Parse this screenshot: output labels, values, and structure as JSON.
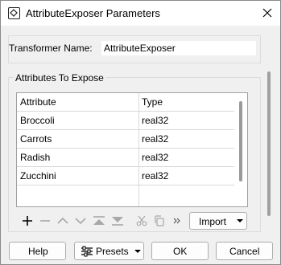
{
  "window": {
    "title": "AttributeExposer Parameters",
    "icons": {
      "app": "transformer-icon",
      "close": "close-icon"
    }
  },
  "transformer_name": {
    "label": "Transformer Name:",
    "value": "AttributeExposer"
  },
  "attributes_group": {
    "title": "Attributes To Expose",
    "columns": [
      "Attribute",
      "Type"
    ],
    "rows": [
      {
        "attribute": "Broccoli",
        "type": "real32"
      },
      {
        "attribute": "Carrots",
        "type": "real32"
      },
      {
        "attribute": "Radish",
        "type": "real32"
      },
      {
        "attribute": "Zucchini",
        "type": "real32"
      }
    ]
  },
  "toolbar": {
    "icons": [
      "add-icon",
      "remove-icon",
      "move-up-icon",
      "move-down-icon",
      "move-top-icon",
      "move-bottom-icon",
      "cut-icon",
      "copy-icon",
      "more-icon"
    ],
    "import_label": "Import"
  },
  "footer": {
    "help_label": "Help",
    "presets_label": "Presets",
    "ok_label": "OK",
    "cancel_label": "Cancel"
  }
}
